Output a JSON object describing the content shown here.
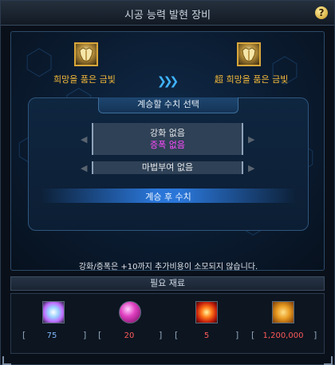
{
  "window": {
    "title": "시공 능력 발현 장비",
    "help_label": "?"
  },
  "source_item": {
    "name": "희망을 품은 금빛",
    "icon": "golden-armor-icon"
  },
  "target_item": {
    "name": "超 희망을 품은 금빛",
    "icon": "golden-armor-icon"
  },
  "transfer_arrow": "❯❯❯",
  "selection": {
    "header": "계승할 수치 선택",
    "option_line1": "강화 없음",
    "option_line2": "증폭 없음",
    "magic_seal": "마법부여 없음",
    "after_label": "계승 후 수치",
    "left_arrow": "◀",
    "right_arrow": "▶"
  },
  "notice": "강화/증폭은 +10까지 추가비용이 소모되지 않습니다.",
  "required": {
    "label": "필요 재료",
    "materials": [
      {
        "icon": "crystal-icon",
        "value": "75",
        "color": "#7fb6ff"
      },
      {
        "icon": "pink-orb-icon",
        "value": "20",
        "color": "#ff5a5a"
      },
      {
        "icon": "fire-burst-icon",
        "value": "5",
        "color": "#ff5a5a"
      },
      {
        "icon": "gold-coins-icon",
        "value": "1,200,000",
        "color": "#ff5a5a"
      }
    ]
  },
  "colors": {
    "accent_blue": "#3fb4ff",
    "item_gold": "#f0b83a",
    "magenta": "#ff4bff",
    "insufficient_red": "#ff5a5a"
  }
}
